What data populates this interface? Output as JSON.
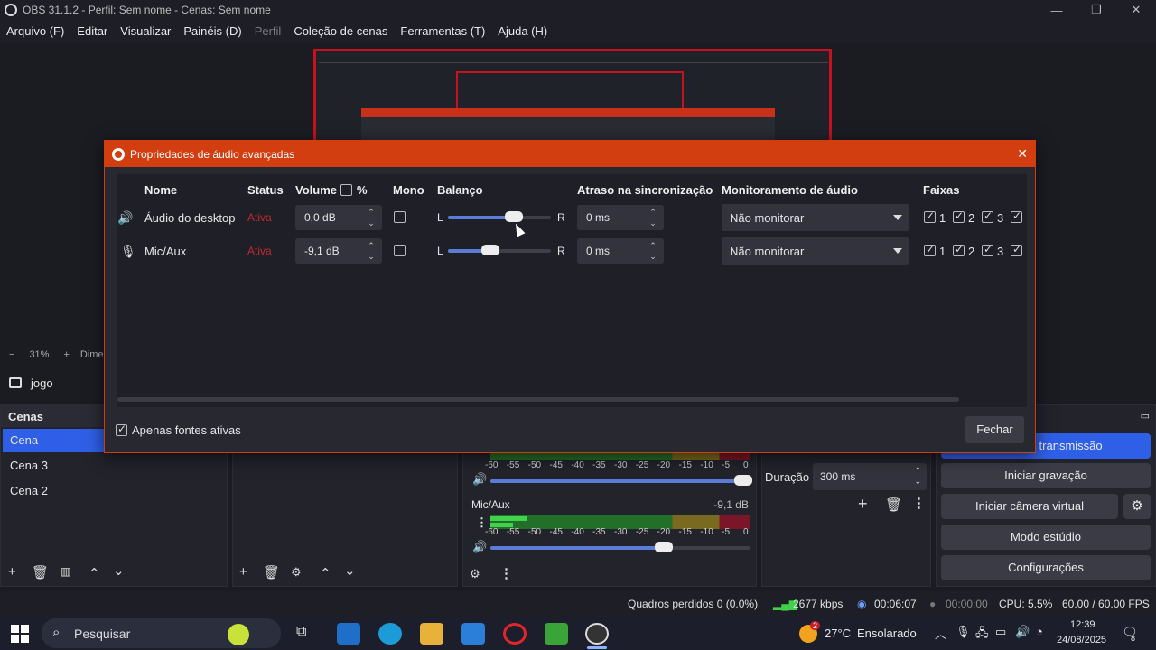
{
  "window": {
    "title": "OBS 31.1.2 - Perfil: Sem nome - Cenas: Sem nome"
  },
  "menu": [
    "Arquivo (F)",
    "Editar",
    "Visualizar",
    "Painéis (D)",
    "Perfil",
    "Coleção de cenas",
    "Ferramentas (T)",
    "Ajuda (H)"
  ],
  "zoom": {
    "percent": "31%",
    "dims_label": "Dime"
  },
  "source_bar": {
    "scene_name": "jogo"
  },
  "scenes": {
    "title": "Cenas",
    "items": [
      "Cena",
      "Cena 3",
      "Cena 2"
    ],
    "selected": 0
  },
  "mixer": {
    "ticks": [
      "-60",
      "-55",
      "-50",
      "-45",
      "-40",
      "-35",
      "-30",
      "-25",
      "-20",
      "-15",
      "-10",
      "-5",
      "0"
    ],
    "mic": {
      "name": "Mic/Aux",
      "db": "-9,1 dB"
    }
  },
  "transitions": {
    "duration_label": "Duração",
    "duration_value": "300 ms"
  },
  "controls": {
    "stream": "Iniciar transmissão",
    "stream_visible": "er transmissão",
    "record": "Iniciar gravação",
    "virtual_cam": "Iniciar câmera virtual",
    "studio": "Modo estúdio",
    "settings": "Configurações"
  },
  "status": {
    "dropped": "Quadros perdidos 0 (0.0%)",
    "bitrate": "2677 kbps",
    "stream_time": "00:06:07",
    "rec_time": "00:00:00",
    "cpu": "CPU: 5.5%",
    "fps": "60.00 / 60.00 FPS"
  },
  "dialog": {
    "title": "Propriedades de áudio avançadas",
    "headers": {
      "name": "Nome",
      "status": "Status",
      "volume": "Volume",
      "percent": "%",
      "mono": "Mono",
      "balance": "Balanço",
      "sync": "Atraso na sincronização",
      "monitoring": "Monitoramento de áudio",
      "tracks": "Faixas"
    },
    "rows": [
      {
        "name": "Áudio do desktop",
        "status": "Ativa",
        "volume": "0,0 dB",
        "mono": false,
        "balance": 0.6,
        "L": "L",
        "R": "R",
        "sync": "0 ms",
        "monitoring": "Não monitorar",
        "tracks": [
          "1",
          "2",
          "3",
          ""
        ]
      },
      {
        "name": "Mic/Aux",
        "status": "Ativa",
        "volume": "-9,1 dB",
        "mono": false,
        "balance": 0.4,
        "L": "L",
        "R": "R",
        "sync": "0 ms",
        "monitoring": "Não monitorar",
        "tracks": [
          "1",
          "2",
          "3",
          ""
        ]
      }
    ],
    "active_only_label": "Apenas fontes ativas",
    "active_only": true,
    "close_label": "Fechar"
  },
  "taskbar": {
    "search_placeholder": "Pesquisar",
    "weather_temp": "27°C",
    "weather_desc": "Ensolarado",
    "weather_badge": "2",
    "time": "12:39",
    "date": "24/08/2025",
    "notif_count": "8"
  },
  "colors": {
    "accent": "#d23e10",
    "selected": "#2f5fe6",
    "status_active": "#c0292e"
  }
}
